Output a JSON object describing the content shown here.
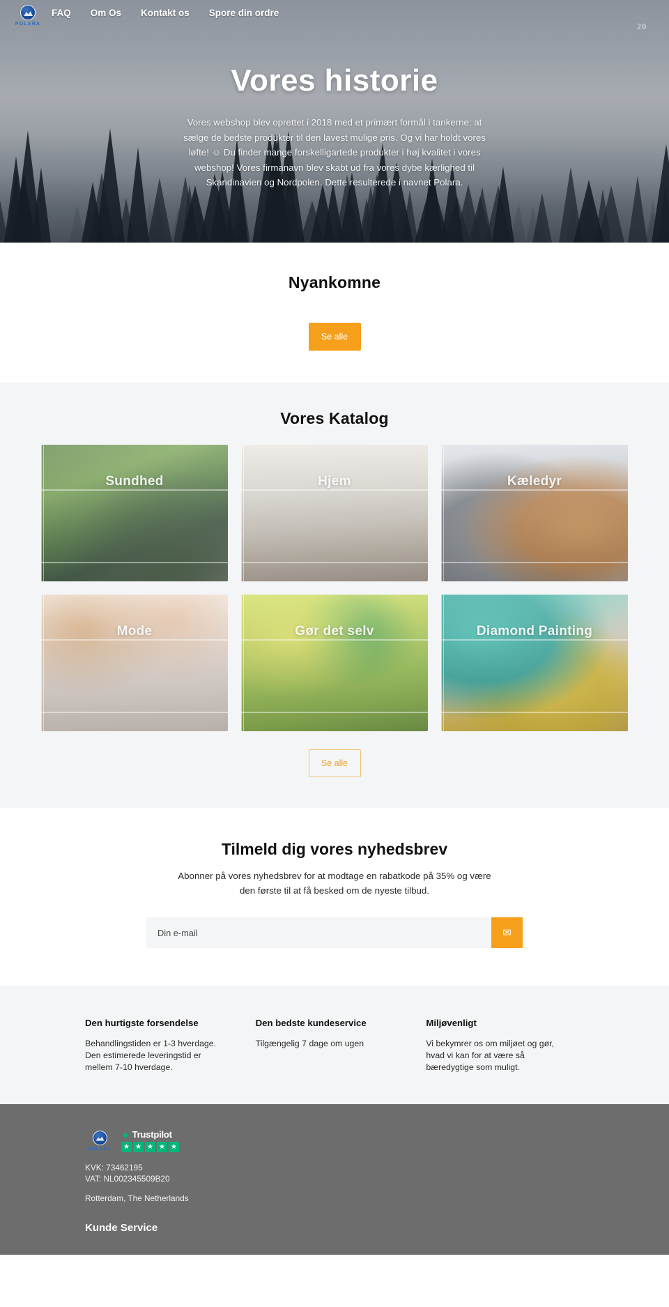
{
  "brand": {
    "name": "POLARA",
    "logo_icon": "polara-compass-logo"
  },
  "nav": {
    "items": [
      {
        "label": "FAQ"
      },
      {
        "label": "Om Os"
      },
      {
        "label": "Kontakt os"
      },
      {
        "label": "Spore din ordre"
      }
    ],
    "counter": "20"
  },
  "hero": {
    "title": "Vores historie",
    "body": "Vores webshop blev oprettet i 2018 med et primært formål i tankerne: at sælge de bedste produkter til den lavest mulige pris. Og vi har holdt vores løfte! ☺ Du finder mange forskelligartede produkter i høj kvalitet i vores webshop! Vores firmanavn blev skabt ud fra vores dybe kærlighed til Skandinavien og Nordpolen. Dette resulterede i navnet Polara."
  },
  "new_arrivals": {
    "title": "Nyankomne",
    "see_all_label": "Se alle"
  },
  "catalog": {
    "title": "Vores Katalog",
    "see_all_label": "Se alle",
    "tiles": [
      {
        "label": "Sundhed",
        "art": "img-sundhed"
      },
      {
        "label": "Hjem",
        "art": "img-hjem"
      },
      {
        "label": "Kæledyr",
        "art": "img-kaeledyr"
      },
      {
        "label": "Mode",
        "art": "img-mode"
      },
      {
        "label": "Gør det selv",
        "art": "img-gds"
      },
      {
        "label": "Diamond Painting",
        "art": "img-diamond"
      }
    ]
  },
  "newsletter": {
    "title": "Tilmeld dig vores nyhedsbrev",
    "subtitle": "Abonner på vores nyhedsbrev for at modtage en rabatkode på 35% og være den første til at få besked om de nyeste tilbud.",
    "email_placeholder": "Din e-mail",
    "email_value": "",
    "submit_icon": "envelope-icon"
  },
  "features": [
    {
      "heading": "Den hurtigste forsendelse",
      "text": "Behandlingstiden er 1-3 hverdage. Den estimerede leveringstid er mellem 7-10 hverdage."
    },
    {
      "heading": "Den bedste kundeservice",
      "text": "Tilgængelig 7 dage om ugen"
    },
    {
      "heading": "Miljøvenligt",
      "text": "Vi bekymrer os om miljøet og gør, hvad vi kan for at være så bæredygtige som muligt."
    }
  ],
  "footer": {
    "trustpilot_label": "Trustpilot",
    "trustpilot_rating": 5,
    "kvk": "KVK: 73462195",
    "vat": "VAT: NL002345509B20",
    "address": "Rotterdam, The Netherlands",
    "customer_service_heading": "Kunde Service"
  },
  "colors": {
    "accent_orange": "#f59f1b",
    "outline_orange": "#eec274",
    "trustpilot_green": "#00b67a",
    "footer_bg": "#6d6d6d",
    "section_gray": "#f4f5f6"
  }
}
